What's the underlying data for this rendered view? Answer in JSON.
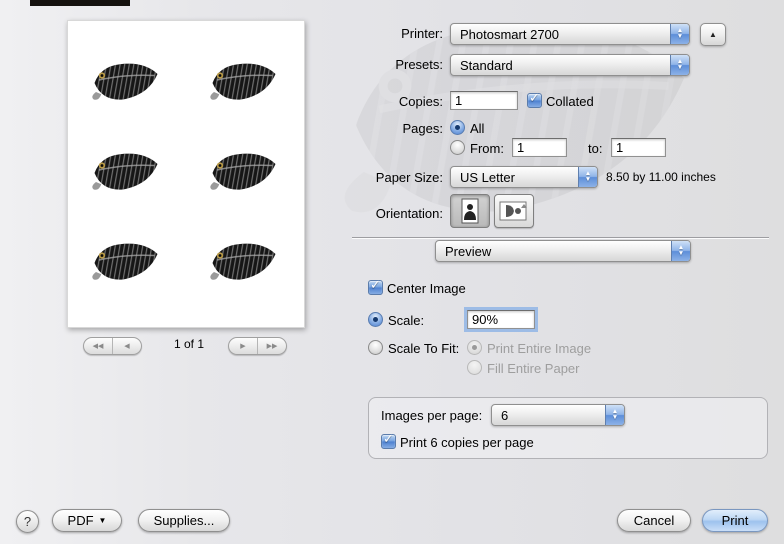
{
  "colors": {
    "accent_blue": "#4f86d8",
    "window_bg": "#e4e4e8"
  },
  "icons": {
    "popup_up_arrow": "▲",
    "popup_down_arrow": "▼",
    "spinner_up_arrow": "▲",
    "checkmark": "✓",
    "nav_first": "◀◀",
    "nav_prev": "◀",
    "nav_next": "▶",
    "nav_last": "▶▶",
    "help": "?",
    "pdf_caret": "▼"
  },
  "print_dialog": {
    "printer": {
      "label": "Printer:",
      "value": "Photosmart 2700"
    },
    "presets": {
      "label": "Presets:",
      "value": "Standard"
    },
    "copies": {
      "label": "Copies:",
      "value": "1",
      "collated_label": "Collated"
    },
    "pages": {
      "label": "Pages:",
      "all_label": "All",
      "from_label": "From:",
      "from_value": "1",
      "to_label": "to:",
      "to_value": "1"
    },
    "paper_size": {
      "label": "Paper Size:",
      "value": "US Letter",
      "detail": "8.50 by 11.00 inches"
    },
    "orientation": {
      "label": "Orientation:"
    },
    "pane_selector": {
      "value": "Preview"
    },
    "preview_options": {
      "center_image_label": "Center Image",
      "scale_label": "Scale:",
      "scale_value": "90%",
      "scale_to_fit_label": "Scale To Fit:",
      "print_entire_image_label": "Print Entire Image",
      "fill_entire_paper_label": "Fill Entire Paper"
    },
    "images_panel": {
      "images_per_page_label": "Images per page:",
      "images_per_page_value": "6",
      "print_copies_label": "Print 6 copies per page"
    }
  },
  "preview_pane": {
    "page_indicator": "1 of 1"
  },
  "footer": {
    "pdf_label": "PDF",
    "supplies_label": "Supplies...",
    "cancel_label": "Cancel",
    "print_label": "Print"
  }
}
